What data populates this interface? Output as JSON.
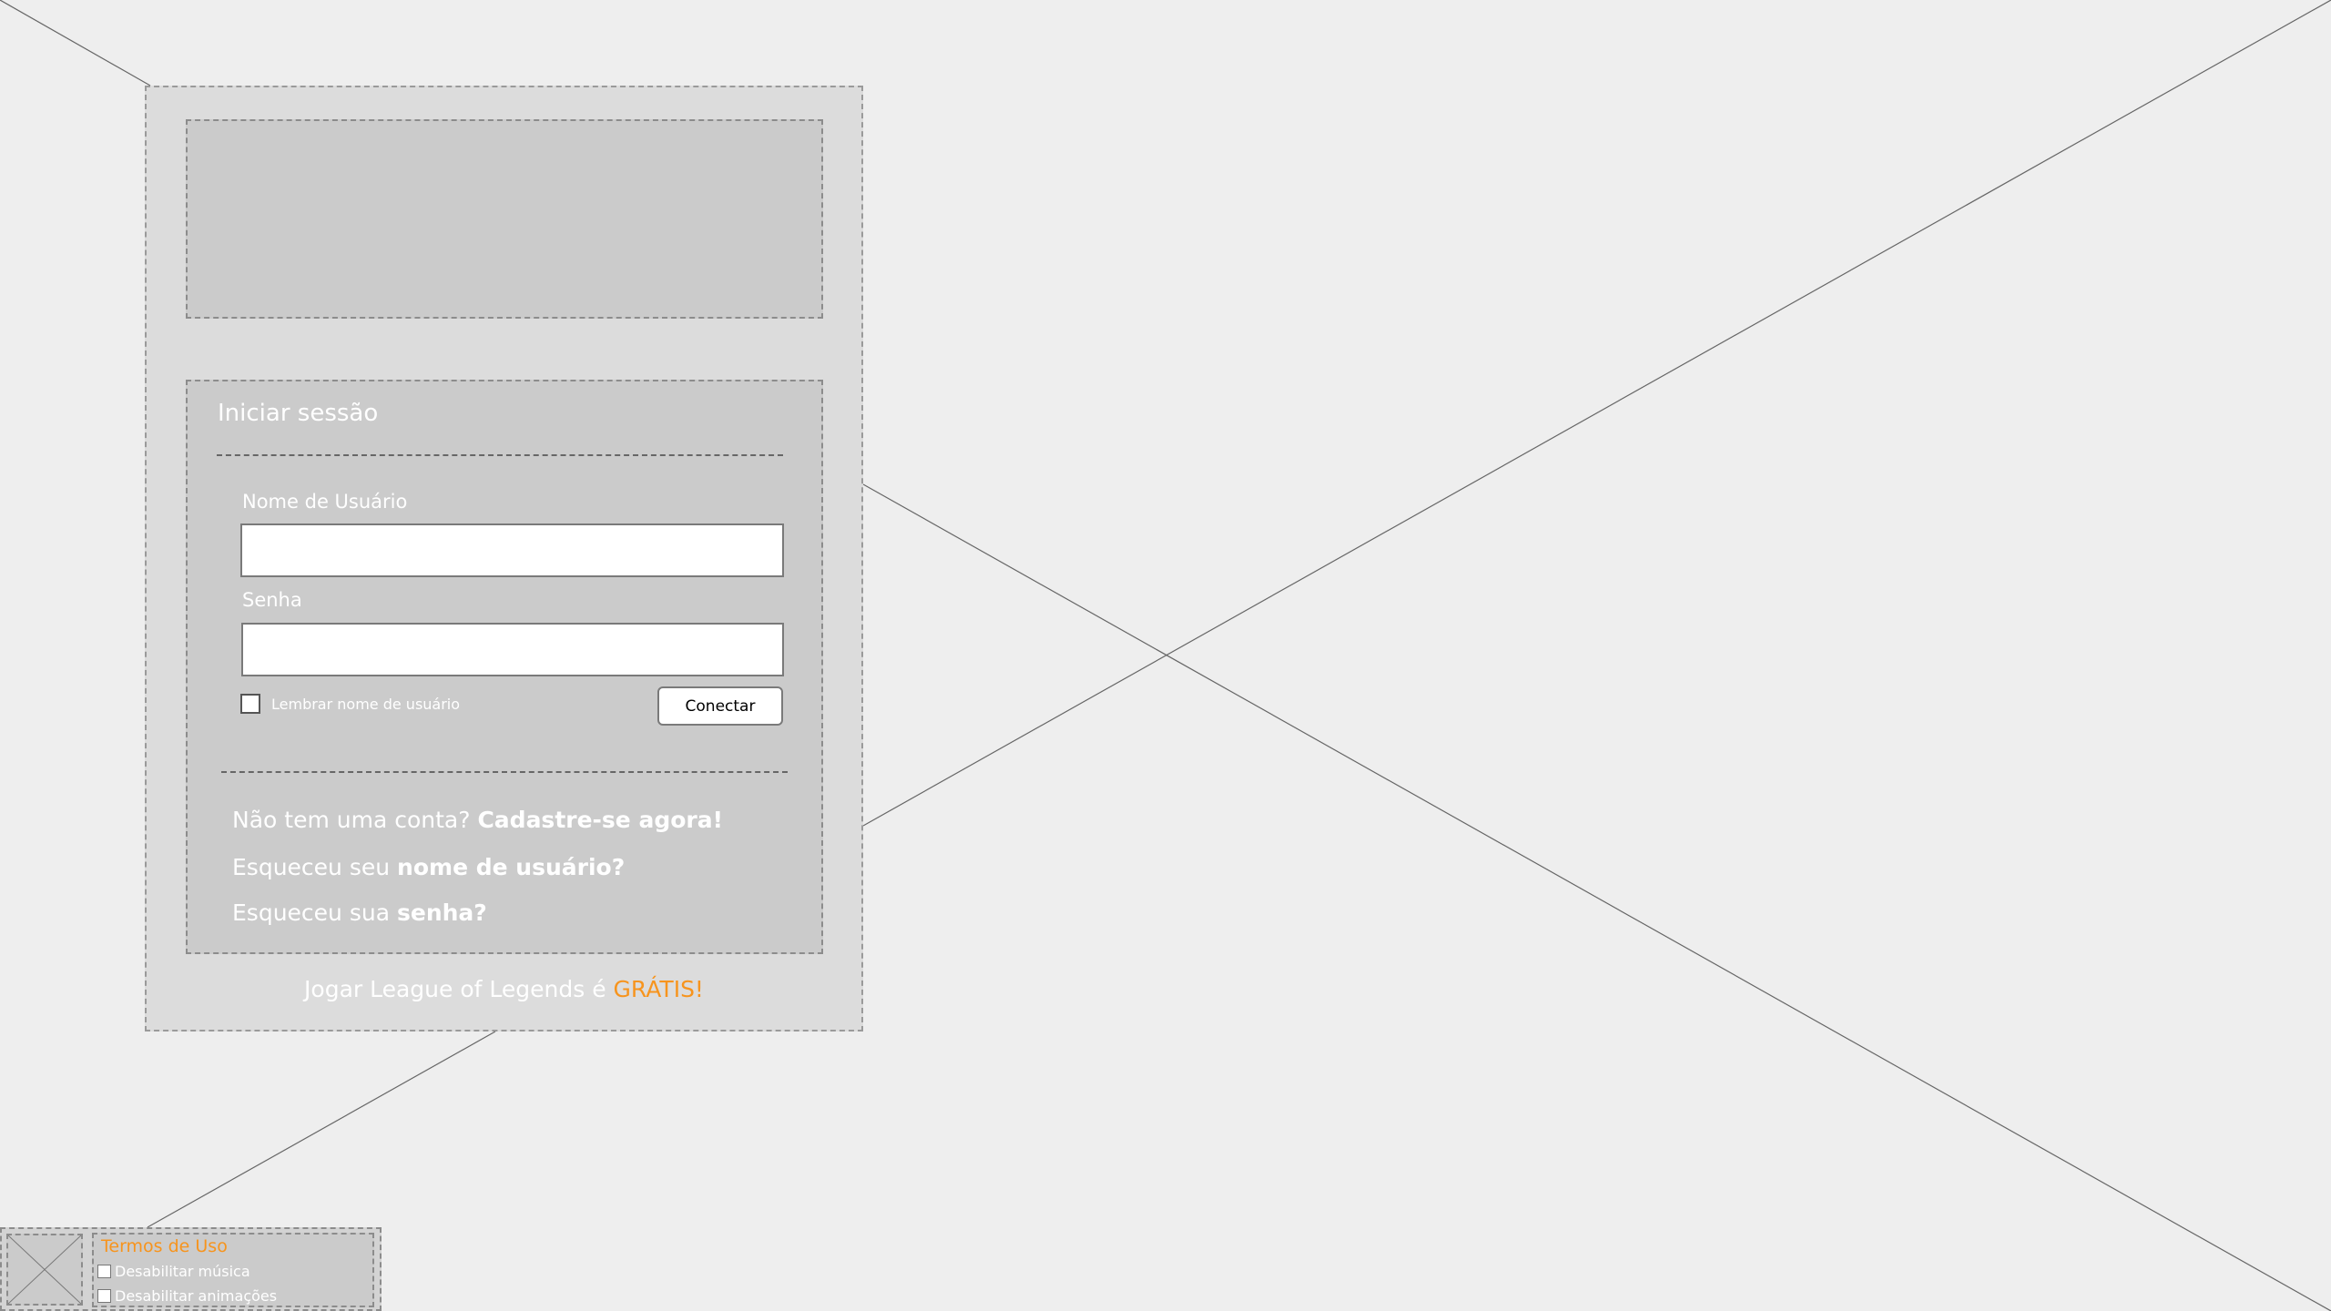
{
  "login": {
    "title": "Iniciar sessão",
    "username_label": "Nome de Usuário",
    "username_value": "",
    "password_label": "Senha",
    "password_value": "",
    "remember_label": "Lembrar nome de usuário",
    "remember_checked": false,
    "connect_label": "Conectar"
  },
  "help": {
    "no_account_text": "Não tem uma conta?",
    "signup_link": "Cadastre-se agora!",
    "forgot_user_text": "Esqueceu seu",
    "forgot_user_link": "nome de usuário?",
    "forgot_pass_text": "Esqueceu sua",
    "forgot_pass_link": "senha?"
  },
  "promo": {
    "text": "Jogar League of Legends é",
    "accent": "GRÁTIS!"
  },
  "footer": {
    "terms_link": "Termos de Uso",
    "disable_music": "Desabilitar música",
    "disable_animations": "Desabilitar animações"
  },
  "colors": {
    "background": "#eeeeee",
    "panel": "#dcdcdc",
    "box": "#cbcbcb",
    "accent": "#f7941d"
  }
}
